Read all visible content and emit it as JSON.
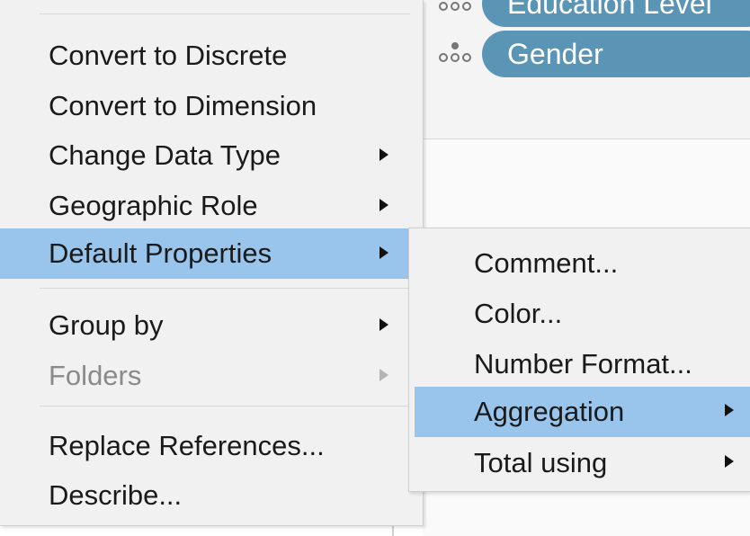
{
  "fields_shelf": {
    "pills": [
      {
        "label": "Education Level",
        "icon": "nominal-dimension-icon"
      },
      {
        "label": "Gender",
        "icon": "nominal-dimension-icon"
      }
    ],
    "pill_color": "#5b95b6"
  },
  "context_menu": {
    "items": [
      {
        "label": "Convert to Discrete"
      },
      {
        "label": "Convert to Dimension"
      },
      {
        "label": "Change Data Type",
        "has_submenu": true
      },
      {
        "label": "Geographic Role",
        "has_submenu": true
      },
      {
        "label": "Default Properties",
        "has_submenu": true,
        "highlighted": true
      },
      {
        "label": "Group by",
        "has_submenu": true
      },
      {
        "label": "Folders",
        "has_submenu": true,
        "disabled": true
      },
      {
        "label": "Replace References..."
      },
      {
        "label": "Describe..."
      }
    ],
    "highlight_color": "#99c4ec"
  },
  "submenu": {
    "items": [
      {
        "label": "Comment..."
      },
      {
        "label": "Color..."
      },
      {
        "label": "Number Format..."
      },
      {
        "label": "Aggregation",
        "has_submenu": true,
        "highlighted": true
      },
      {
        "label": "Total using",
        "has_submenu": true
      }
    ]
  }
}
